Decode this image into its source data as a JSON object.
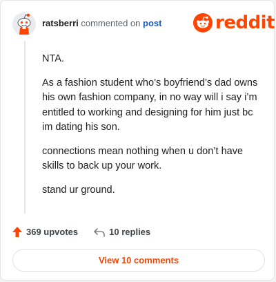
{
  "comment": {
    "username": "ratsberri",
    "action_text": "commented on",
    "target_text": "post",
    "paragraphs": [
      "NTA.",
      "As a fashion student who’s boyfriend’s dad owns his own fashion company, in no way will i say i’m entitled to working and designing for him just bc im dating his son.",
      "connections mean nothing when u don’t have skills to back up your work.",
      "stand ur ground."
    ]
  },
  "brand": {
    "logo_text": "reddit",
    "logo_icon": "reddit-snoo-icon",
    "accent_color": "#ff4500"
  },
  "stats": {
    "upvotes_label": "369 upvotes",
    "upvote_icon": "upvote-arrow-icon",
    "replies_label": "10 replies",
    "reply_icon": "reply-icon"
  },
  "view_button": {
    "label": "View 10 comments"
  }
}
